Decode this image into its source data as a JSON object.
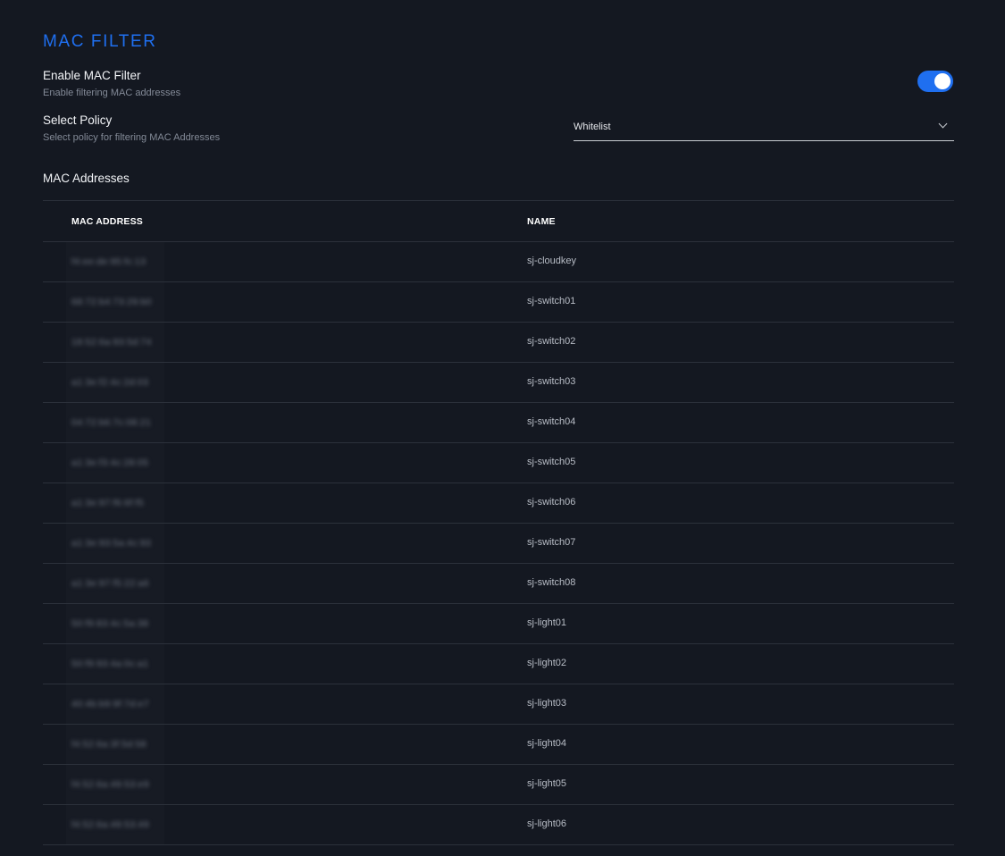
{
  "section": {
    "title": "MAC FILTER"
  },
  "enable": {
    "label": "Enable MAC Filter",
    "description": "Enable filtering MAC addresses",
    "enabled": true
  },
  "policy": {
    "label": "Select Policy",
    "description": "Select policy for filtering MAC Addresses",
    "selected": "Whitelist"
  },
  "addresses": {
    "title": "MAC Addresses",
    "columns": {
      "mac": "MAC ADDRESS",
      "name": "NAME"
    },
    "rows": [
      {
        "mac": "f4:ee:de:95:fc:13",
        "name": "sj-cloudkey"
      },
      {
        "mac": "68:72:b4:73:29:b0",
        "name": "sj-switch01"
      },
      {
        "mac": "18:52:6a:93:5d:74",
        "name": "sj-switch02"
      },
      {
        "mac": "a1:3e:f2:4c:2d:03",
        "name": "sj-switch03"
      },
      {
        "mac": "04:72:b6:7c:08:21",
        "name": "sj-switch04"
      },
      {
        "mac": "a1:3e:f3:4c:28:05",
        "name": "sj-switch05"
      },
      {
        "mac": "a1:3e:97:f6:6f:f5",
        "name": "sj-switch06"
      },
      {
        "mac": "a1:3e:93:5a:4c:93",
        "name": "sj-switch07"
      },
      {
        "mac": "a1:3e:97:f5:22:a6",
        "name": "sj-switch08"
      },
      {
        "mac": "50:f9:83:4c:5a:38",
        "name": "sj-light01"
      },
      {
        "mac": "50:f9:93:4a:0c:a1",
        "name": "sj-light02"
      },
      {
        "mac": "40:4b:b9:9f:7d:e7",
        "name": "sj-light03"
      },
      {
        "mac": "f4:52:6a:3f:5d:58",
        "name": "sj-light04"
      },
      {
        "mac": "f4:52:6a:49:53:e9",
        "name": "sj-light05"
      },
      {
        "mac": "f4:52:6a:49:53:49",
        "name": "sj-light06"
      }
    ]
  }
}
